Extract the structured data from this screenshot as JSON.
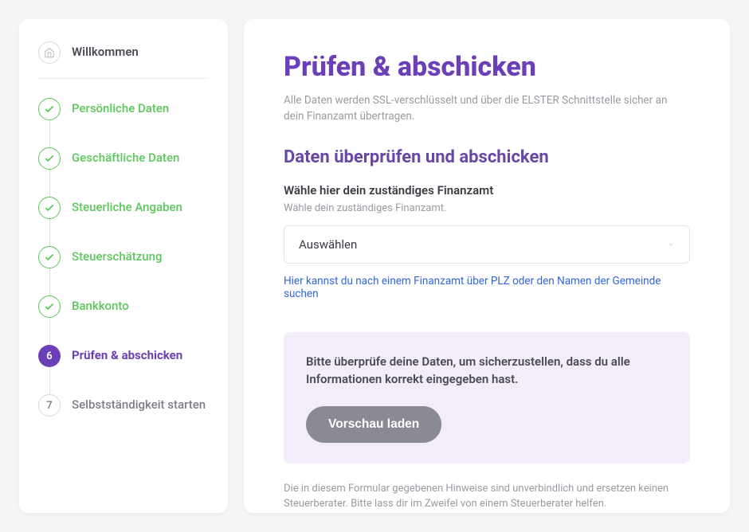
{
  "sidebar": {
    "items": [
      {
        "label": "Willkommen"
      },
      {
        "label": "Persönliche Daten"
      },
      {
        "label": "Geschäftliche Daten"
      },
      {
        "label": "Steuerliche Angaben"
      },
      {
        "label": "Steuerschätzung"
      },
      {
        "label": "Bankkonto"
      },
      {
        "label": "Prüfen & abschicken",
        "number": "6"
      },
      {
        "label": "Selbstständigkeit starten",
        "number": "7"
      }
    ]
  },
  "main": {
    "title": "Prüfen & abschicken",
    "subtitle": "Alle Daten werden SSL-verschlüsselt und über die ELSTER Schnittstelle sicher an dein Finanzamt übertragen.",
    "section_title": "Daten überprüfen und abschicken",
    "field_label": "Wähle hier dein zuständiges Finanzamt",
    "field_help": "Wähle dein zuständiges Finanzamt.",
    "select_placeholder": "Auswählen",
    "search_link": "Hier kannst du nach einem Finanzamt über PLZ oder den Namen der Gemeinde suchen",
    "info_text": "Bitte überprüfe deine Daten, um sicherzustellen, dass du alle Informationen korrekt eingegeben hast.",
    "preview_button": "Vorschau laden",
    "disclaimer": "Die in diesem Formular gegebenen Hinweise sind unverbindlich und ersetzen keinen Steuerberater. Bitte lass dir im Zweifel von einem Steuerberater helfen."
  }
}
